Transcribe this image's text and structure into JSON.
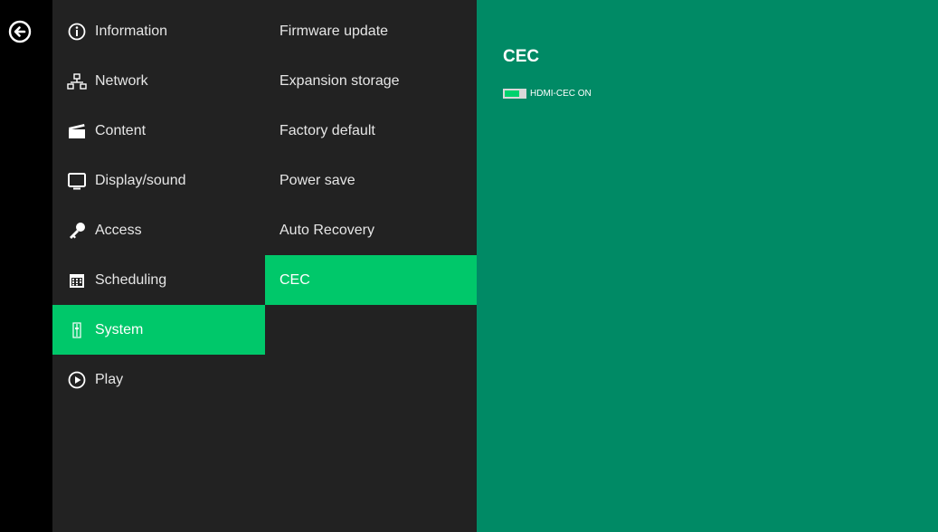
{
  "menu1": {
    "items": [
      {
        "label": "Information",
        "icon": "info-icon"
      },
      {
        "label": "Network",
        "icon": "network-icon"
      },
      {
        "label": "Content",
        "icon": "clapperboard-icon"
      },
      {
        "label": "Display/sound",
        "icon": "monitor-icon"
      },
      {
        "label": "Access",
        "icon": "key-icon"
      },
      {
        "label": "Scheduling",
        "icon": "calendar-icon"
      },
      {
        "label": "System",
        "icon": "sliders-icon",
        "active": true
      },
      {
        "label": "Play",
        "icon": "play-circle-icon"
      }
    ]
  },
  "menu2": {
    "items": [
      {
        "label": "Firmware update"
      },
      {
        "label": "Expansion storage"
      },
      {
        "label": "Factory default"
      },
      {
        "label": "Power save"
      },
      {
        "label": "Auto Recovery"
      },
      {
        "label": "CEC",
        "active": true
      }
    ]
  },
  "content": {
    "title": "CEC",
    "toggle": {
      "label": "HDMI-CEC ON",
      "on": true
    }
  },
  "colors": {
    "accent": "#00c86a",
    "panel": "#008a65",
    "menu_bg": "#222222"
  }
}
